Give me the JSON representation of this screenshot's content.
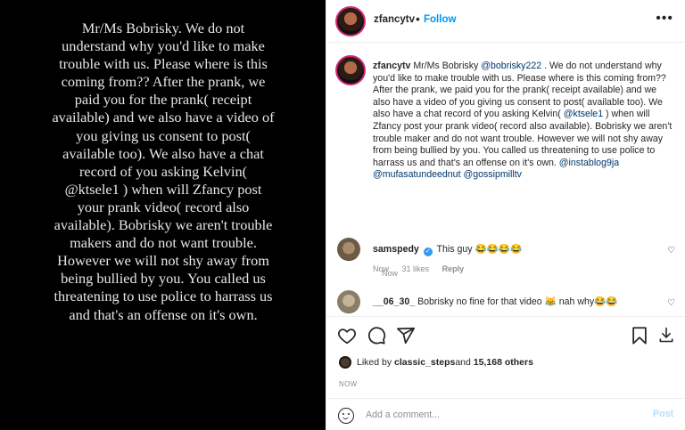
{
  "media": {
    "text": "Mr/Ms Bobrisky. We do not understand why you'd like to make trouble with us. Please where is this coming from?? After the prank, we paid you for the prank( receipt available) and we also have a video of you giving us consent to post( available too). We also have a chat record of you asking Kelvin( @ktsele1 ) when will Zfancy post your prank video( record also available). Bobrisky we aren't trouble makers and do not want trouble. However we will not shy away from being bullied by you. You called us threatening to use police to harrass us and that's an offense on it's own."
  },
  "header": {
    "username": "zfancytv",
    "separator": "•",
    "follow_label": "Follow",
    "more_label": "•••"
  },
  "caption": {
    "username": "zfancytv",
    "text_before_mention": " Mr/Ms Bobrisky ",
    "mention_1": "@bobrisky222",
    "text_main": " . We do not understand why you'd like to make trouble with us. Please where is this coming from?? After the prank, we paid you for the prank( receipt available) and we also have a video of you giving us consent to post( available too). We also have a chat record of you asking Kelvin( ",
    "mention_2": "@ktsele1",
    "text_after": " ) when will Zfancy post your prank video( record also available). Bobrisky we aren't trouble maker and do not want trouble. However we will not shy away from being bullied by you. You called us threatening to use police to harrass us and that's an offense on it's own. ",
    "tag_1": "@instablog9ja",
    "tag_2": "@mufasatundeednut",
    "tag_3": "@gossipmilltv",
    "time": "Now"
  },
  "comments": [
    {
      "username": "samspedy",
      "verified_mark": "✓",
      "text": " This guy 😂😂😂😂",
      "time": "Now",
      "likes": "31 likes",
      "reply": "Reply"
    },
    {
      "username": "__06_30_",
      "text": " Bobrisky no fine for that video 😹 nah why😂😂"
    }
  ],
  "likes": {
    "prefix": "Liked by ",
    "user": "classic_steps",
    "middle": " and ",
    "count": "15,168 others"
  },
  "post_time": "NOW",
  "add_comment": {
    "placeholder": "Add a comment...",
    "post_label": "Post"
  },
  "icons": [
    "heart-icon",
    "comment-icon",
    "share-icon",
    "bookmark-icon",
    "save-download-icon",
    "emoji-icon"
  ]
}
